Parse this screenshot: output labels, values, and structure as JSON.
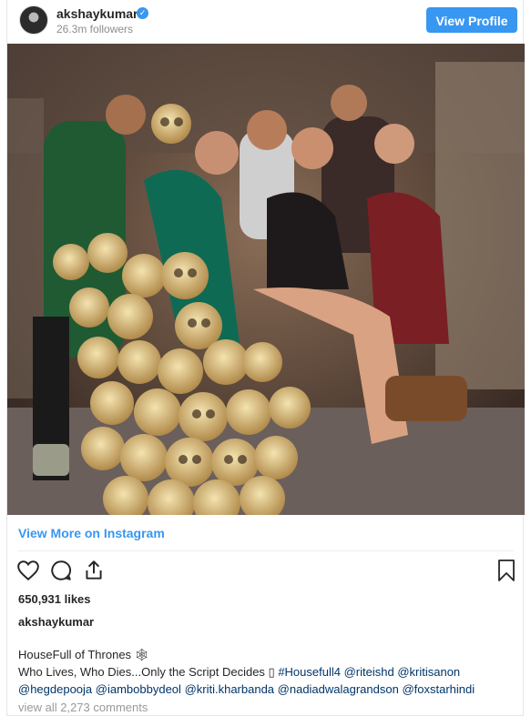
{
  "header": {
    "username": "akshaykumar",
    "verified_icon": "verified-badge-icon",
    "followers": "26.3m followers",
    "view_profile_label": "View Profile"
  },
  "post": {
    "image_icon": "post-photo",
    "view_more_label": "View More on Instagram",
    "actions": {
      "like_icon": "heart-icon",
      "comment_icon": "comment-icon",
      "share_icon": "share-icon",
      "save_icon": "bookmark-icon"
    },
    "likes": "650,931 likes",
    "owner": "akshaykumar",
    "caption_line1": "HouseFull of Thrones 🕸",
    "caption_line2_text": "Who Lives, Who Dies...Only the Script Decides ▯ ",
    "tags": [
      "#Housefull4",
      "@riteishd",
      "@kritisanon",
      "@hegdepooja",
      "@iambobbydeol",
      "@kriti.kharbanda",
      "@nadiadwalagrandson",
      "@foxstarhindi"
    ],
    "view_comments": "view all 2,273 comments"
  },
  "colors": {
    "accent": "#3897f0",
    "tag": "#003569",
    "muted": "#8e8e8e"
  }
}
